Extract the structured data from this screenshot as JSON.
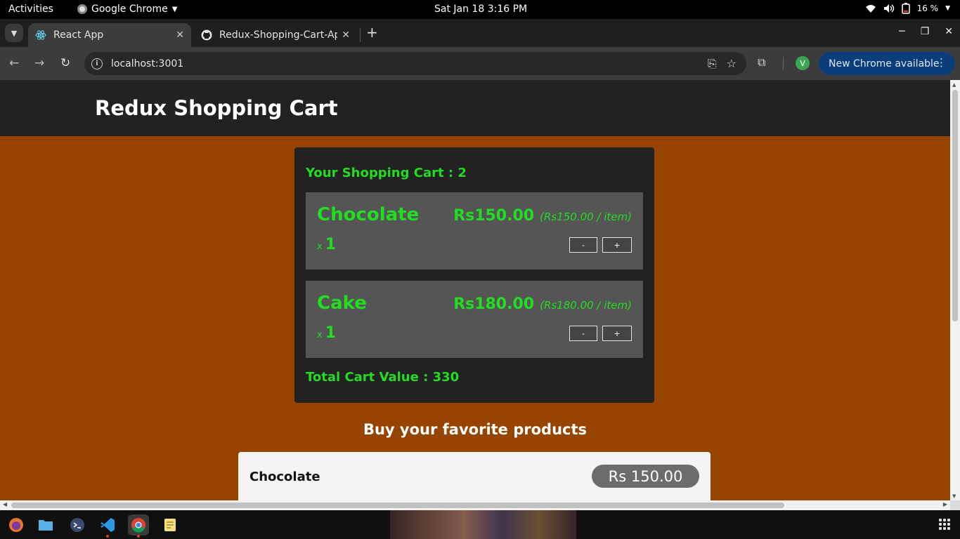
{
  "system": {
    "activities": "Activities",
    "app_name": "Google Chrome",
    "clock": "Sat Jan 18  3:16 PM",
    "battery": "16 %"
  },
  "browser": {
    "tabs": [
      {
        "title": "React App",
        "icon": "react-icon"
      },
      {
        "title": "Redux-Shopping-Cart-Ap",
        "icon": "github-icon"
      }
    ],
    "url": "localhost:3001",
    "profile_initial": "V",
    "update_label": "New Chrome available"
  },
  "page": {
    "site_title": "Redux Shopping Cart",
    "cart": {
      "title": "Your Shopping Cart : 2",
      "items": [
        {
          "name": "Chocolate",
          "price": "Rs150.00",
          "per_item": "(Rs150.00 / item)",
          "qty_prefix": "x",
          "qty": "1",
          "minus": "-",
          "plus": "+"
        },
        {
          "name": "Cake",
          "price": "Rs180.00",
          "per_item": "(Rs180.00 / item)",
          "qty_prefix": "x",
          "qty": "1",
          "minus": "-",
          "plus": "+"
        }
      ],
      "total": "Total Cart Value : 330"
    },
    "products_title": "Buy your favorite products",
    "products": [
      {
        "name": "Chocolate",
        "price": "Rs 150.00"
      }
    ]
  },
  "colors": {
    "page_bg": "#964400",
    "header_bg": "#222222",
    "accent_green": "#22dd22",
    "item_bg": "#555555"
  }
}
